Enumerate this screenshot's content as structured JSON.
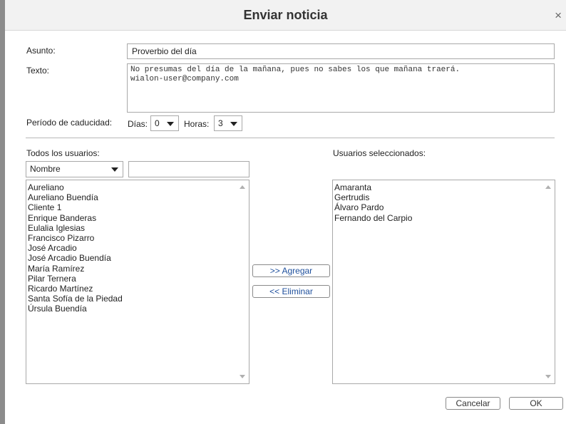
{
  "dialog": {
    "title": "Enviar noticia",
    "close_symbol": "×"
  },
  "form": {
    "subject_label": "Asunto:",
    "subject_value": "Proverbio del día",
    "text_label": "Texto:",
    "text_lines": [
      "No presumas del día de la mañana, pues no sabes los que mañana traerá.",
      "wialon-user@company.com"
    ],
    "expiry_label": "Período de caducidad:",
    "days_label": "Días:",
    "days_value": "0",
    "hours_label": "Horas:",
    "hours_value": "3"
  },
  "all_users": {
    "label": "Todos los usuarios:",
    "filter_field": "Nombre",
    "filter_text": "",
    "items": [
      "Aureliano",
      "Aureliano Buendía",
      "Cliente 1",
      "Enrique Banderas",
      "Eulalia Iglesias",
      "Francisco Pizarro",
      "José Arcadio",
      "José Arcadio Buendía",
      "María Ramírez",
      "Pilar Ternera",
      "Ricardo Martínez",
      "Santa Sofía de la Piedad",
      "Úrsula Buendía"
    ]
  },
  "transfer": {
    "add_label": ">> Agregar",
    "remove_label": "<< Eliminar"
  },
  "selected_users": {
    "label": "Usuarios seleccionados:",
    "items": [
      "Amaranta",
      "Gertrudis",
      "Álvaro Pardo",
      "Fernando del Carpio"
    ]
  },
  "footer": {
    "cancel_label": "Cancelar",
    "ok_label": "OK"
  },
  "colors": {
    "accent_text": "#1e4f9c",
    "border": "#a9a9a9",
    "titlebar_bg": "#f2f2f2"
  }
}
